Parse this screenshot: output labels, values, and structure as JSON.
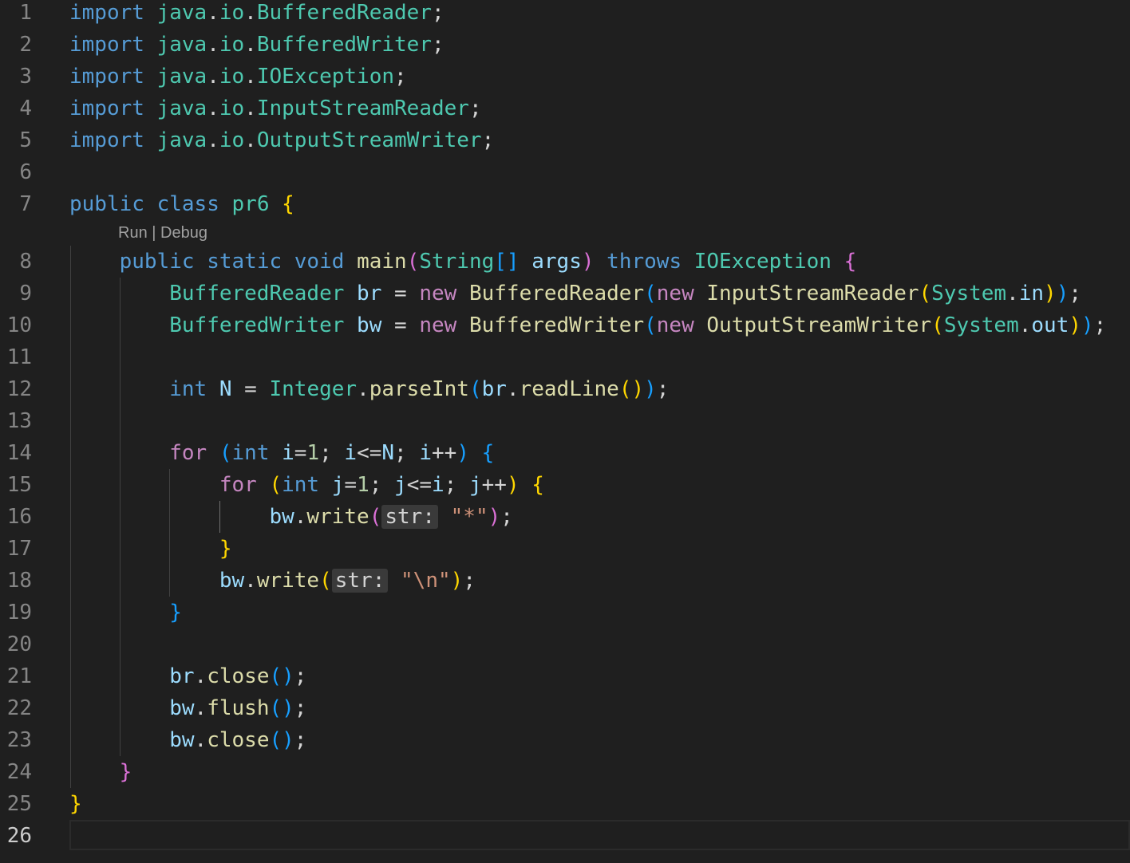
{
  "editor": {
    "active_line": 26,
    "codelens": {
      "run": "Run",
      "sep": " | ",
      "debug": "Debug"
    },
    "inlay_hint": "str:",
    "lines": [
      {
        "n": "1",
        "tokens": [
          [
            "kw",
            "import"
          ],
          [
            "punc",
            " "
          ],
          [
            "pkg",
            "java"
          ],
          [
            "punc",
            "."
          ],
          [
            "pkg",
            "io"
          ],
          [
            "punc",
            "."
          ],
          [
            "cls",
            "BufferedReader"
          ],
          [
            "punc",
            ";"
          ]
        ]
      },
      {
        "n": "2",
        "tokens": [
          [
            "kw",
            "import"
          ],
          [
            "punc",
            " "
          ],
          [
            "pkg",
            "java"
          ],
          [
            "punc",
            "."
          ],
          [
            "pkg",
            "io"
          ],
          [
            "punc",
            "."
          ],
          [
            "cls",
            "BufferedWriter"
          ],
          [
            "punc",
            ";"
          ]
        ]
      },
      {
        "n": "3",
        "tokens": [
          [
            "kw",
            "import"
          ],
          [
            "punc",
            " "
          ],
          [
            "pkg",
            "java"
          ],
          [
            "punc",
            "."
          ],
          [
            "pkg",
            "io"
          ],
          [
            "punc",
            "."
          ],
          [
            "cls",
            "IOException"
          ],
          [
            "punc",
            ";"
          ]
        ]
      },
      {
        "n": "4",
        "tokens": [
          [
            "kw",
            "import"
          ],
          [
            "punc",
            " "
          ],
          [
            "pkg",
            "java"
          ],
          [
            "punc",
            "."
          ],
          [
            "pkg",
            "io"
          ],
          [
            "punc",
            "."
          ],
          [
            "cls",
            "InputStreamReader"
          ],
          [
            "punc",
            ";"
          ]
        ]
      },
      {
        "n": "5",
        "tokens": [
          [
            "kw",
            "import"
          ],
          [
            "punc",
            " "
          ],
          [
            "pkg",
            "java"
          ],
          [
            "punc",
            "."
          ],
          [
            "pkg",
            "io"
          ],
          [
            "punc",
            "."
          ],
          [
            "cls",
            "OutputStreamWriter"
          ],
          [
            "punc",
            ";"
          ]
        ]
      },
      {
        "n": "6",
        "tokens": []
      },
      {
        "n": "7",
        "tokens": [
          [
            "kw",
            "public"
          ],
          [
            "punc",
            " "
          ],
          [
            "kw",
            "class"
          ],
          [
            "punc",
            " "
          ],
          [
            "cls",
            "pr6"
          ],
          [
            "punc",
            " "
          ],
          [
            "p1",
            "{"
          ]
        ]
      },
      {
        "n": "8",
        "tokens": [
          [
            "punc",
            "    "
          ],
          [
            "kw",
            "public"
          ],
          [
            "punc",
            " "
          ],
          [
            "kw",
            "static"
          ],
          [
            "punc",
            " "
          ],
          [
            "kw",
            "void"
          ],
          [
            "punc",
            " "
          ],
          [
            "fn",
            "main"
          ],
          [
            "p2",
            "("
          ],
          [
            "cls",
            "String"
          ],
          [
            "p3",
            "[]"
          ],
          [
            "punc",
            " "
          ],
          [
            "var",
            "args"
          ],
          [
            "p2",
            ")"
          ],
          [
            "punc",
            " "
          ],
          [
            "kw",
            "throws"
          ],
          [
            "punc",
            " "
          ],
          [
            "cls",
            "IOException"
          ],
          [
            "punc",
            " "
          ],
          [
            "p2",
            "{"
          ]
        ]
      },
      {
        "n": "9",
        "tokens": [
          [
            "punc",
            "        "
          ],
          [
            "cls",
            "BufferedReader"
          ],
          [
            "punc",
            " "
          ],
          [
            "var",
            "br"
          ],
          [
            "punc",
            " = "
          ],
          [
            "kw2",
            "new"
          ],
          [
            "punc",
            " "
          ],
          [
            "fn",
            "BufferedReader"
          ],
          [
            "p3",
            "("
          ],
          [
            "kw2",
            "new"
          ],
          [
            "punc",
            " "
          ],
          [
            "fn",
            "InputStreamReader"
          ],
          [
            "p1",
            "("
          ],
          [
            "cls",
            "System"
          ],
          [
            "punc",
            "."
          ],
          [
            "var",
            "in"
          ],
          [
            "p1",
            ")"
          ],
          [
            "p3",
            ")"
          ],
          [
            "punc",
            ";"
          ]
        ]
      },
      {
        "n": "10",
        "tokens": [
          [
            "punc",
            "        "
          ],
          [
            "cls",
            "BufferedWriter"
          ],
          [
            "punc",
            " "
          ],
          [
            "var",
            "bw"
          ],
          [
            "punc",
            " = "
          ],
          [
            "kw2",
            "new"
          ],
          [
            "punc",
            " "
          ],
          [
            "fn",
            "BufferedWriter"
          ],
          [
            "p3",
            "("
          ],
          [
            "kw2",
            "new"
          ],
          [
            "punc",
            " "
          ],
          [
            "fn",
            "OutputStreamWriter"
          ],
          [
            "p1",
            "("
          ],
          [
            "cls",
            "System"
          ],
          [
            "punc",
            "."
          ],
          [
            "var",
            "out"
          ],
          [
            "p1",
            ")"
          ],
          [
            "p3",
            ")"
          ],
          [
            "punc",
            ";"
          ]
        ]
      },
      {
        "n": "11",
        "tokens": []
      },
      {
        "n": "12",
        "tokens": [
          [
            "punc",
            "        "
          ],
          [
            "kw",
            "int"
          ],
          [
            "punc",
            " "
          ],
          [
            "var",
            "N"
          ],
          [
            "punc",
            " = "
          ],
          [
            "cls",
            "Integer"
          ],
          [
            "punc",
            "."
          ],
          [
            "fn",
            "parseInt"
          ],
          [
            "p3",
            "("
          ],
          [
            "var",
            "br"
          ],
          [
            "punc",
            "."
          ],
          [
            "fn",
            "readLine"
          ],
          [
            "p1",
            "()"
          ],
          [
            "p3",
            ")"
          ],
          [
            "punc",
            ";"
          ]
        ]
      },
      {
        "n": "13",
        "tokens": []
      },
      {
        "n": "14",
        "tokens": [
          [
            "punc",
            "        "
          ],
          [
            "kw2",
            "for"
          ],
          [
            "punc",
            " "
          ],
          [
            "p3",
            "("
          ],
          [
            "kw",
            "int"
          ],
          [
            "punc",
            " "
          ],
          [
            "var",
            "i"
          ],
          [
            "punc",
            "="
          ],
          [
            "num",
            "1"
          ],
          [
            "punc",
            "; "
          ],
          [
            "var",
            "i"
          ],
          [
            "punc",
            "<="
          ],
          [
            "var",
            "N"
          ],
          [
            "punc",
            "; "
          ],
          [
            "var",
            "i"
          ],
          [
            "punc",
            "++"
          ],
          [
            "p3",
            ")"
          ],
          [
            "punc",
            " "
          ],
          [
            "p3",
            "{"
          ]
        ]
      },
      {
        "n": "15",
        "tokens": [
          [
            "punc",
            "            "
          ],
          [
            "kw2",
            "for"
          ],
          [
            "punc",
            " "
          ],
          [
            "p1",
            "("
          ],
          [
            "kw",
            "int"
          ],
          [
            "punc",
            " "
          ],
          [
            "var",
            "j"
          ],
          [
            "punc",
            "="
          ],
          [
            "num",
            "1"
          ],
          [
            "punc",
            "; "
          ],
          [
            "var",
            "j"
          ],
          [
            "punc",
            "<="
          ],
          [
            "var",
            "i"
          ],
          [
            "punc",
            "; "
          ],
          [
            "var",
            "j"
          ],
          [
            "punc",
            "++"
          ],
          [
            "p1",
            ")"
          ],
          [
            "punc",
            " "
          ],
          [
            "p1",
            "{"
          ]
        ]
      },
      {
        "n": "16",
        "tokens": [
          [
            "punc",
            "                "
          ],
          [
            "var",
            "bw"
          ],
          [
            "punc",
            "."
          ],
          [
            "fn",
            "write"
          ],
          [
            "p2",
            "("
          ],
          [
            "hint",
            "str:"
          ],
          [
            "punc",
            " "
          ],
          [
            "str",
            "\"*\""
          ],
          [
            "p2",
            ")"
          ],
          [
            "punc",
            ";"
          ]
        ]
      },
      {
        "n": "17",
        "tokens": [
          [
            "punc",
            "            "
          ],
          [
            "p1",
            "}"
          ]
        ]
      },
      {
        "n": "18",
        "tokens": [
          [
            "punc",
            "            "
          ],
          [
            "var",
            "bw"
          ],
          [
            "punc",
            "."
          ],
          [
            "fn",
            "write"
          ],
          [
            "p1",
            "("
          ],
          [
            "hint",
            "str:"
          ],
          [
            "punc",
            " "
          ],
          [
            "str",
            "\"\\n\""
          ],
          [
            "p1",
            ")"
          ],
          [
            "punc",
            ";"
          ]
        ]
      },
      {
        "n": "19",
        "tokens": [
          [
            "punc",
            "        "
          ],
          [
            "p3",
            "}"
          ]
        ]
      },
      {
        "n": "20",
        "tokens": []
      },
      {
        "n": "21",
        "tokens": [
          [
            "punc",
            "        "
          ],
          [
            "var",
            "br"
          ],
          [
            "punc",
            "."
          ],
          [
            "fn",
            "close"
          ],
          [
            "p3",
            "()"
          ],
          [
            "punc",
            ";"
          ]
        ]
      },
      {
        "n": "22",
        "tokens": [
          [
            "punc",
            "        "
          ],
          [
            "var",
            "bw"
          ],
          [
            "punc",
            "."
          ],
          [
            "fn",
            "flush"
          ],
          [
            "p3",
            "()"
          ],
          [
            "punc",
            ";"
          ]
        ]
      },
      {
        "n": "23",
        "tokens": [
          [
            "punc",
            "        "
          ],
          [
            "var",
            "bw"
          ],
          [
            "punc",
            "."
          ],
          [
            "fn",
            "close"
          ],
          [
            "p3",
            "()"
          ],
          [
            "punc",
            ";"
          ]
        ]
      },
      {
        "n": "24",
        "tokens": [
          [
            "punc",
            "    "
          ],
          [
            "p2",
            "}"
          ]
        ]
      },
      {
        "n": "25",
        "tokens": [
          [
            "p1",
            "}"
          ]
        ]
      },
      {
        "n": "26",
        "tokens": []
      }
    ]
  }
}
